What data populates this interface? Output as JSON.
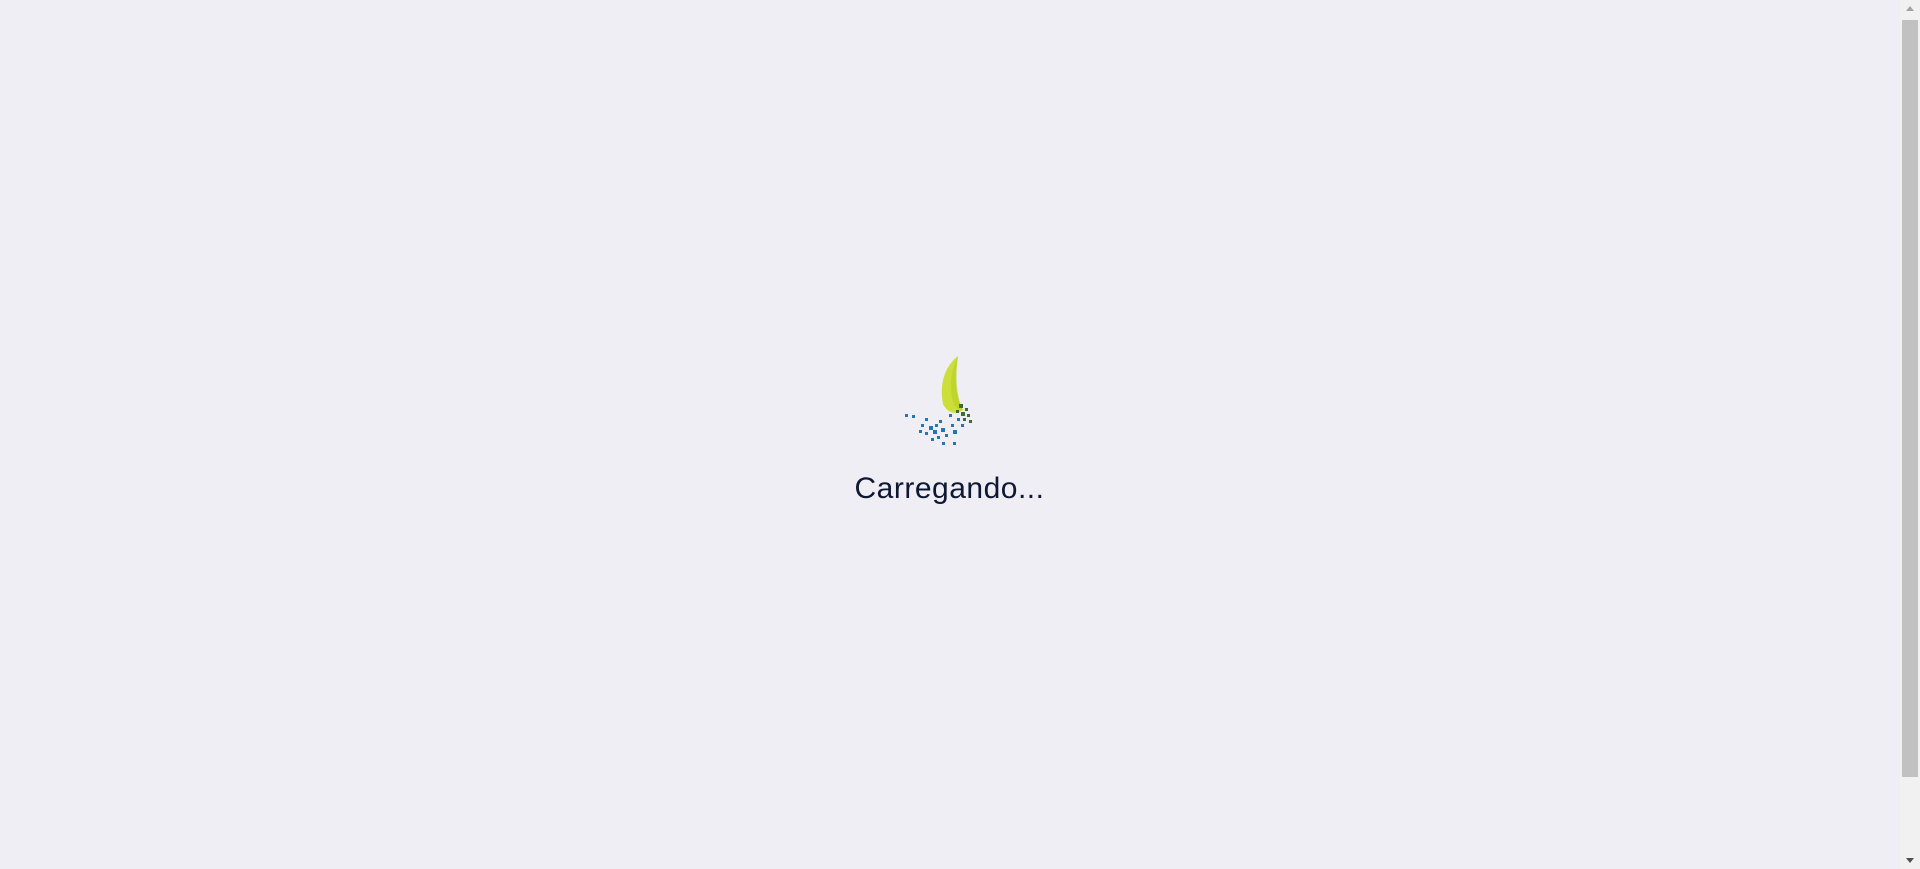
{
  "loader": {
    "text": "Carregando...",
    "logo_icon": "spinning-leaf-logo-icon",
    "colors": {
      "leaf": "#c9dc2e",
      "dots_blue": "#1f78b4",
      "dots_green": "#3f8f3a",
      "text": "#0e1733",
      "background": "#efeef4"
    }
  },
  "scrollbar": {
    "up_icon": "chevron-up-icon",
    "down_icon": "chevron-down-icon"
  }
}
